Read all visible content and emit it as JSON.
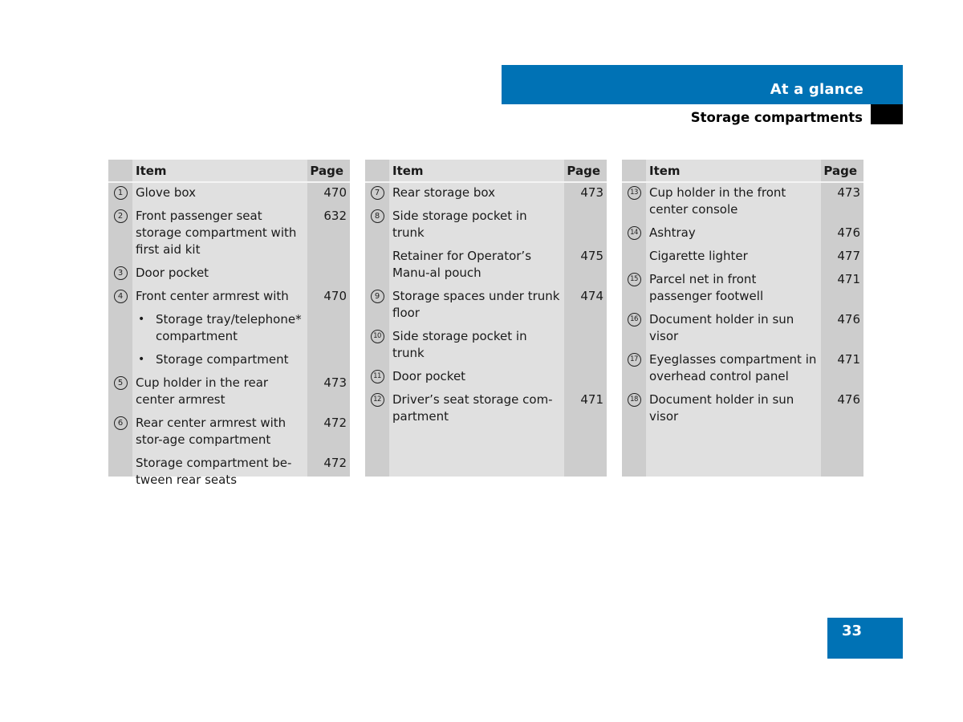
{
  "header": {
    "chapter": "At a glance",
    "section": "Storage compartments"
  },
  "tables": [
    {
      "col_item": "Item",
      "col_page": "Page",
      "rows": [
        {
          "num": "1",
          "text": "Glove box",
          "page": "470"
        },
        {
          "num": "2",
          "text": "Front passenger seat storage compartment with first aid kit",
          "page": "632"
        },
        {
          "num": "3",
          "text": "Door pocket",
          "page": ""
        },
        {
          "num": "4",
          "text": "Front center armrest with",
          "page": "470"
        },
        {
          "num": "",
          "bullet": true,
          "text": "Storage tray/telephone* compartment",
          "page": ""
        },
        {
          "num": "",
          "bullet": true,
          "text": "Storage compartment",
          "page": ""
        },
        {
          "num": "5",
          "text": "Cup holder in the rear center armrest",
          "page": "473"
        },
        {
          "num": "6",
          "text": "Rear center armrest with stor-age compartment",
          "page": "472"
        },
        {
          "num": "",
          "text": "Storage compartment be-tween rear seats",
          "page": "472"
        }
      ]
    },
    {
      "col_item": "Item",
      "col_page": "Page",
      "rows": [
        {
          "num": "7",
          "text": "Rear storage box",
          "page": "473"
        },
        {
          "num": "8",
          "text": "Side storage pocket in trunk",
          "page": ""
        },
        {
          "num": "",
          "text": "Retainer for Operator’s Manu-al pouch",
          "page": "475"
        },
        {
          "num": "9",
          "text": "Storage spaces under trunk floor",
          "page": "474"
        },
        {
          "num": "10",
          "text": "Side storage pocket in trunk",
          "page": ""
        },
        {
          "num": "11",
          "text": "Door pocket",
          "page": ""
        },
        {
          "num": "12",
          "text": "Driver’s seat storage com-partment",
          "page": "471"
        }
      ]
    },
    {
      "col_item": "Item",
      "col_page": "Page",
      "rows": [
        {
          "num": "13",
          "text": "Cup holder in the front center console",
          "page": "473"
        },
        {
          "num": "14",
          "text": "Ashtray",
          "page": "476"
        },
        {
          "num": "",
          "text": "Cigarette lighter",
          "page": "477"
        },
        {
          "num": "15",
          "text": "Parcel net in front passenger footwell",
          "page": "471"
        },
        {
          "num": "16",
          "text": "Document holder in sun visor",
          "page": "476"
        },
        {
          "num": "17",
          "text": "Eyeglasses compartment in overhead control panel",
          "page": "471"
        },
        {
          "num": "18",
          "text": "Document holder in sun visor",
          "page": "476"
        }
      ]
    }
  ],
  "page_number": "33",
  "colors": {
    "brand_blue": "#0072b5",
    "table_body": "#e0e0e0",
    "table_side_columns": "#cdcdcd"
  }
}
